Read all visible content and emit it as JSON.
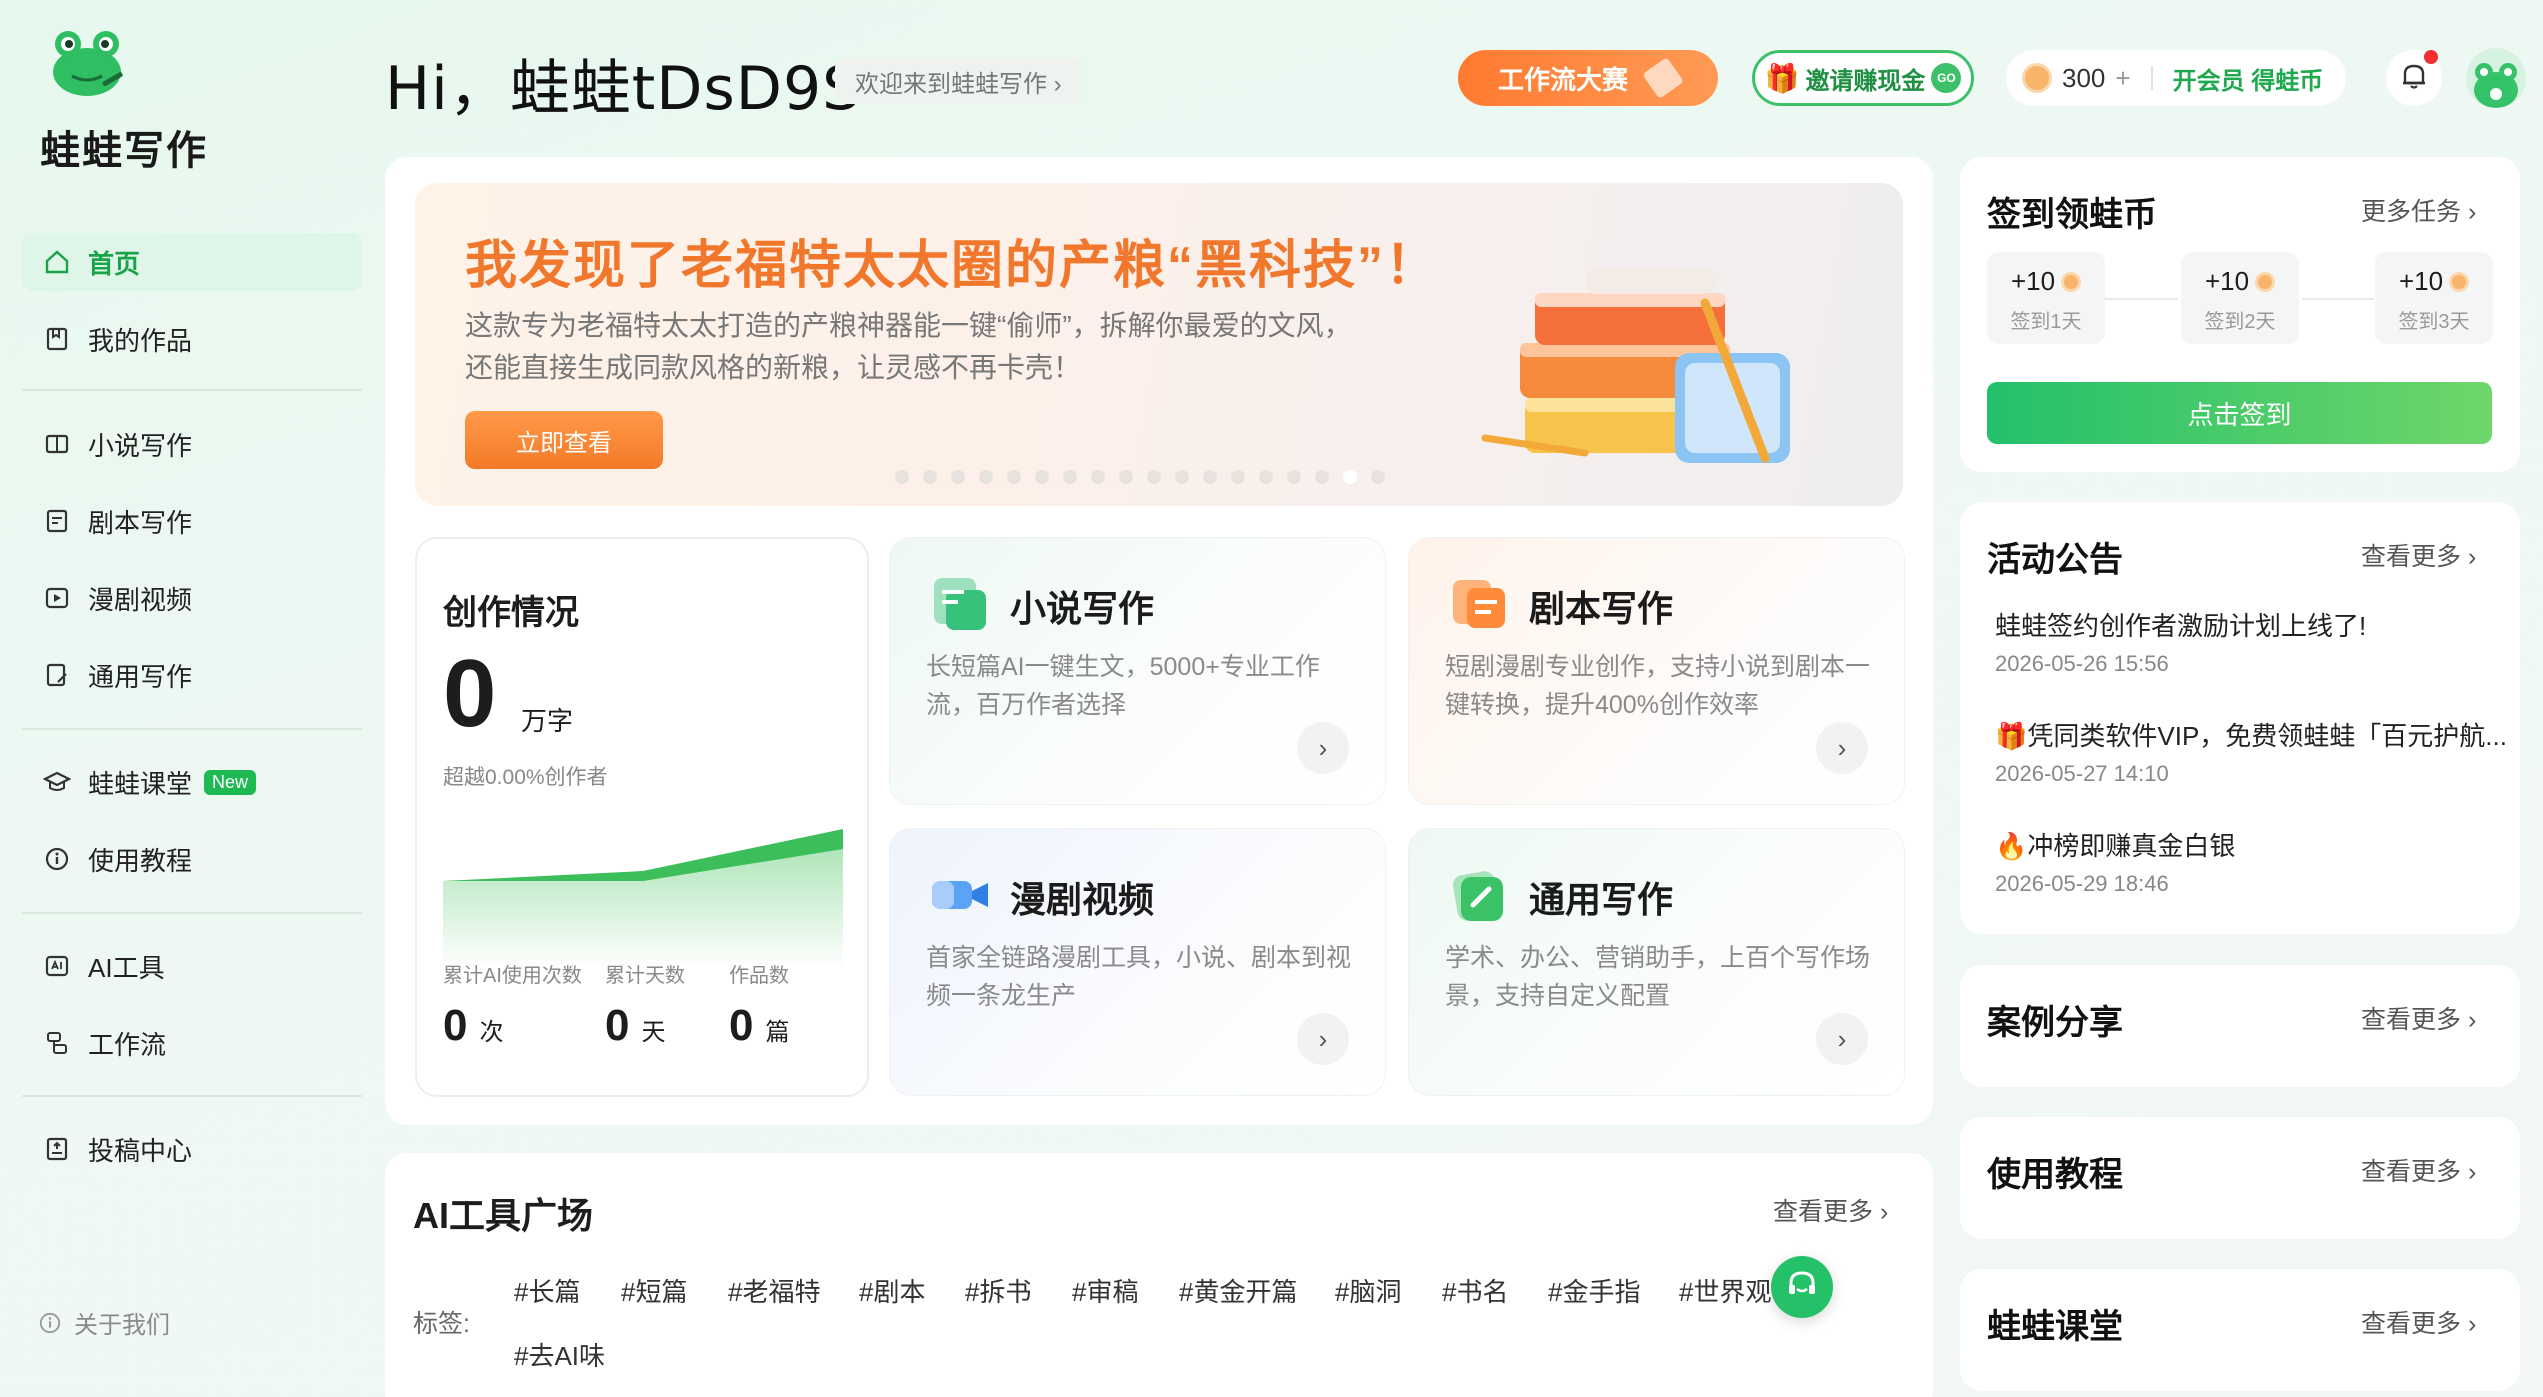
{
  "brand": {
    "name": "蛙蛙写作"
  },
  "sidebar": {
    "items": [
      {
        "label": "首页"
      },
      {
        "label": "我的作品"
      },
      {
        "label": "小说写作"
      },
      {
        "label": "剧本写作"
      },
      {
        "label": "漫剧视频"
      },
      {
        "label": "通用写作"
      },
      {
        "label": "蛙蛙课堂",
        "badge": "New"
      },
      {
        "label": "使用教程"
      },
      {
        "label": "AI工具"
      },
      {
        "label": "工作流"
      },
      {
        "label": "投稿中心"
      }
    ],
    "about": "关于我们"
  },
  "header": {
    "greeting": "Hi，蛙蛙tDsD9S",
    "welcome": "欢迎来到蛙蛙写作 ›",
    "workflow_contest": "工作流大赛",
    "invite": "邀请赚现金",
    "invite_go": "GO",
    "coins": "300",
    "coins_plus": "+",
    "vip": "开会员 得蛙币"
  },
  "banner": {
    "title": "我发现了老福特太太圈的产粮“黑科技”！",
    "line1": "这款专为老福特太太打造的产粮神器能一键“偷师”，拆解你最爱的文风，",
    "line2": "还能直接生成同款风格的新粮，让灵感不再卡壳！",
    "button": "立即查看"
  },
  "stats": {
    "title": "创作情况",
    "words": "0",
    "words_unit": "万字",
    "exceed": "超越0.00%创作者",
    "items": [
      {
        "label": "累计AI使用次数",
        "value": "0",
        "unit": "次"
      },
      {
        "label": "累计天数",
        "value": "0",
        "unit": "天"
      },
      {
        "label": "作品数",
        "value": "0",
        "unit": "篇"
      }
    ]
  },
  "features": [
    {
      "title": "小说写作",
      "desc": "长短篇AI一键生文，5000+专业工作流，百万作者选择"
    },
    {
      "title": "剧本写作",
      "desc": "短剧漫剧专业创作，支持小说到剧本一键转换，提升400%创作效率"
    },
    {
      "title": "漫剧视频",
      "desc": "首家全链路漫剧工具，小说、剧本到视频一条龙生产"
    },
    {
      "title": "通用写作",
      "desc": "学术、办公、营销助手，上百个写作场景，支持自定义配置"
    }
  ],
  "tools": {
    "title": "AI工具广场",
    "more": "查看更多 ›",
    "tag_label": "标签:",
    "tags": [
      "#长篇",
      "#短篇",
      "#老福特",
      "#剧本",
      "#拆书",
      "#审稿",
      "#黄金开篇",
      "#脑洞",
      "#书名",
      "#金手指",
      "#世界观",
      "#去AI味"
    ]
  },
  "checkin": {
    "title": "签到领蛙币",
    "more": "更多任务 ›",
    "days": [
      {
        "reward": "+10",
        "label": "签到1天"
      },
      {
        "reward": "+10",
        "label": "签到2天"
      },
      {
        "reward": "+10",
        "label": "签到3天"
      }
    ],
    "button": "点击签到"
  },
  "notices": {
    "title": "活动公告",
    "more": "查看更多 ›",
    "items": [
      {
        "text": "蛙蛙签约创作者激励计划上线了!",
        "date": "2026-05-26 15:56"
      },
      {
        "text": "🎁凭同类软件VIP，免费领蛙蛙「百元护航...",
        "date": "2026-05-27 14:10"
      },
      {
        "text": "🔥冲榜即赚真金白银",
        "date": "2026-05-29 18:46"
      }
    ]
  },
  "cases": {
    "title": "案例分享",
    "more": "查看更多 ›"
  },
  "tutorial": {
    "title": "使用教程",
    "more": "查看更多 ›"
  },
  "classroom": {
    "title": "蛙蛙课堂",
    "more": "查看更多 ›"
  },
  "colors": {
    "brand_green": "#1fb954",
    "orange": "#f0772c",
    "bg": "#e6f8ee"
  }
}
